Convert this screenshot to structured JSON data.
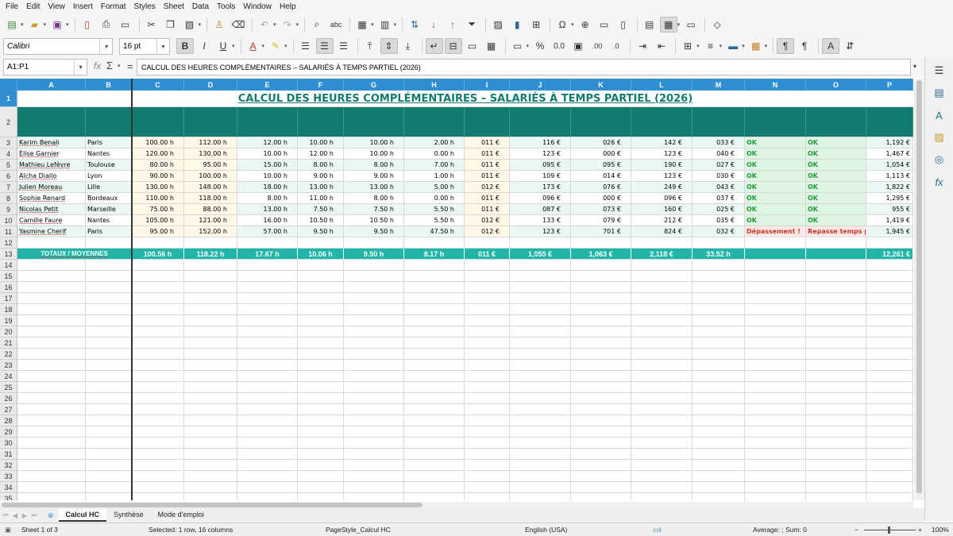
{
  "menu": [
    "File",
    "Edit",
    "View",
    "Insert",
    "Format",
    "Styles",
    "Sheet",
    "Data",
    "Tools",
    "Window",
    "Help"
  ],
  "font": {
    "name": "Calibri",
    "size": "16 pt"
  },
  "namebox": "A1:P1",
  "formula": "CALCUL DES HEURES COMPLÉMENTAIRES – SALARIÉS À TEMPS PARTIEL (2026)",
  "columns": [
    "A",
    "B",
    "C",
    "D",
    "E",
    "F",
    "G",
    "H",
    "I",
    "J",
    "K",
    "L",
    "M",
    "N",
    "O",
    "P"
  ],
  "title": "CALCUL DES HEURES COMPLÉMENTAIRES – SALARIÉS À TEMPS PARTIEL (2026)",
  "employees": [
    {
      "row": "3",
      "name": "Karim Benali",
      "city": "Paris",
      "c": "100.00 h",
      "d": "112.00 h",
      "e": "12.00 h",
      "f": "10.00 h",
      "g": "10.00 h",
      "h": "2.00 h",
      "i": "011 €",
      "j": "116 €",
      "k": "026 €",
      "l": "142 €",
      "m": "033 €",
      "n": "OK",
      "o": "OK",
      "p": "1,192 €"
    },
    {
      "row": "4",
      "name": "Élise Garnier",
      "city": "Nantes",
      "c": "120.00 h",
      "d": "130.00 h",
      "e": "10.00 h",
      "f": "12.00 h",
      "g": "10.00 h",
      "h": "0.00 h",
      "i": "011 €",
      "j": "123 €",
      "k": "000 €",
      "l": "123 €",
      "m": "040 €",
      "n": "OK",
      "o": "OK",
      "p": "1,467 €"
    },
    {
      "row": "5",
      "name": "Mathieu Lefèvre",
      "city": "Toulouse",
      "c": "80.00 h",
      "d": "95.00 h",
      "e": "15.00 h",
      "f": "8.00 h",
      "g": "8.00 h",
      "h": "7.00 h",
      "i": "011 €",
      "j": "095 €",
      "k": "095 €",
      "l": "190 €",
      "m": "027 €",
      "n": "OK",
      "o": "OK",
      "p": "1,054 €"
    },
    {
      "row": "6",
      "name": "Aïcha Diallo",
      "city": "Lyon",
      "c": "90.00 h",
      "d": "100.00 h",
      "e": "10.00 h",
      "f": "9.00 h",
      "g": "9.00 h",
      "h": "1.00 h",
      "i": "011 €",
      "j": "109 €",
      "k": "014 €",
      "l": "123 €",
      "m": "030 €",
      "n": "OK",
      "o": "OK",
      "p": "1,113 €"
    },
    {
      "row": "7",
      "name": "Julien Moreau",
      "city": "Lille",
      "c": "130.00 h",
      "d": "148.00 h",
      "e": "18.00 h",
      "f": "13.00 h",
      "g": "13.00 h",
      "h": "5.00 h",
      "i": "012 €",
      "j": "173 €",
      "k": "076 €",
      "l": "249 €",
      "m": "043 €",
      "n": "OK",
      "o": "OK",
      "p": "1,822 €"
    },
    {
      "row": "8",
      "name": "Sophie Renard",
      "city": "Bordeaux",
      "c": "110.00 h",
      "d": "118.00 h",
      "e": "8.00 h",
      "f": "11.00 h",
      "g": "8.00 h",
      "h": "0.00 h",
      "i": "011 €",
      "j": "096 €",
      "k": "000 €",
      "l": "096 €",
      "m": "037 €",
      "n": "OK",
      "o": "OK",
      "p": "1,295 €"
    },
    {
      "row": "9",
      "name": "Nicolas Petit",
      "city": "Marseille",
      "c": "75.00 h",
      "d": "88.00 h",
      "e": "13.00 h",
      "f": "7.50 h",
      "g": "7.50 h",
      "h": "5.50 h",
      "i": "011 €",
      "j": "087 €",
      "k": "073 €",
      "l": "160 €",
      "m": "025 €",
      "n": "OK",
      "o": "OK",
      "p": "955 €"
    },
    {
      "row": "10",
      "name": "Camille Faure",
      "city": "Nantes",
      "c": "105.00 h",
      "d": "121.00 h",
      "e": "16.00 h",
      "f": "10.50 h",
      "g": "10.50 h",
      "h": "5.50 h",
      "i": "012 €",
      "j": "133 €",
      "k": "079 €",
      "l": "212 €",
      "m": "035 €",
      "n": "OK",
      "o": "OK",
      "p": "1,419 €"
    },
    {
      "row": "11",
      "name": "Yasmine Cherif",
      "city": "Paris",
      "c": "95.00 h",
      "d": "152.00 h",
      "e": "57.00 h",
      "f": "9.50 h",
      "g": "9.50 h",
      "h": "47.50 h",
      "i": "012 €",
      "j": "123 €",
      "k": "701 €",
      "l": "824 €",
      "m": "032 €",
      "n": "Dépassement !",
      "o": "Repasse temps plein",
      "p": "1,945 €"
    }
  ],
  "totals": {
    "row": "13",
    "label": "TOTAUX / MOYENNES",
    "c": "100.56 h",
    "d": "118.22 h",
    "e": "17.67 h",
    "f": "10.06 h",
    "g": "9.50 h",
    "h": "8.17 h",
    "i": "011 €",
    "j": "1,055 €",
    "k": "1,063 €",
    "l": "2,118 €",
    "m": "33.52 h",
    "n": "",
    "o": "",
    "p": "12,261 €"
  },
  "empty_rows": [
    "12",
    "14",
    "15",
    "16",
    "17",
    "18",
    "19",
    "20",
    "21",
    "22",
    "23",
    "24",
    "25",
    "26",
    "27",
    "28",
    "29",
    "30",
    "31",
    "32",
    "33",
    "34",
    "35"
  ],
  "sheets": [
    {
      "label": "Calcul HC",
      "active": true
    },
    {
      "label": "Synthèse",
      "active": false
    },
    {
      "label": "Mode d'emploi",
      "active": false
    }
  ],
  "status": {
    "sheet": "Sheet 1 of 3",
    "selection": "Selected: 1 row, 16 columns",
    "pagestyle": "PageStyle_Calcul HC",
    "language": "English (USA)",
    "sum": "Average: ; Sum: 0",
    "zoom": "100%"
  },
  "colors": {
    "header_teal": "#127a70",
    "total_teal": "#1fb5a8",
    "ok_green": "#1e9e3a",
    "warn_red": "#c0392b",
    "row_tint": "#eaf7f3",
    "input_tint": "#fff8e6"
  }
}
